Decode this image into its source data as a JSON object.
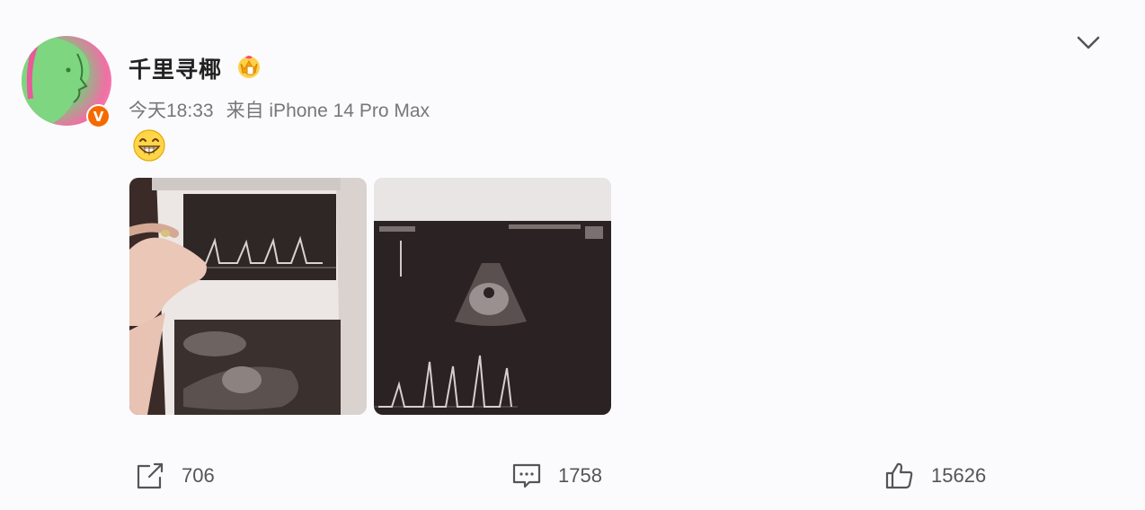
{
  "post": {
    "username": "千里寻椰",
    "time": "今天18:33",
    "source": "来自 iPhone 14 Pro Max",
    "verified_badge": "V",
    "content_emoji": "grinning-face-icon",
    "images": [
      {
        "name": "ultrasound-photo-1",
        "description": "ultrasound printout held in hand"
      },
      {
        "name": "ultrasound-photo-2",
        "description": "ultrasound screen"
      }
    ]
  },
  "actions": {
    "repost_count": "706",
    "comment_count": "1758",
    "like_count": "15626"
  },
  "icons": {
    "more": "chevron-down-icon",
    "repost": "share-icon",
    "comment": "comment-icon",
    "like": "thumbs-up-icon",
    "vip": "crown-icon"
  },
  "colors": {
    "background": "#fbfbfd",
    "badge": "#f56a00",
    "text_primary": "#222222",
    "text_secondary": "#777777"
  }
}
